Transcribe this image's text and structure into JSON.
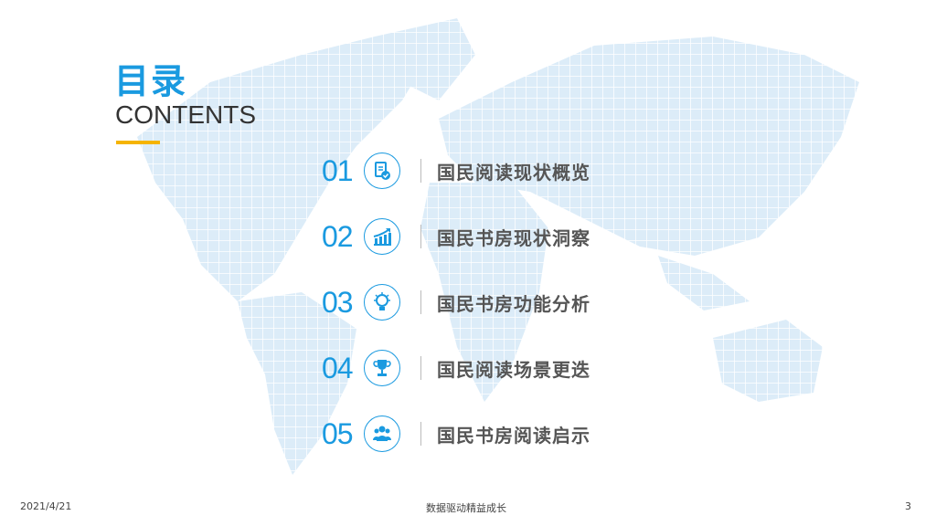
{
  "heading": {
    "title_cn": "目录",
    "title_en": "CONTENTS"
  },
  "items": [
    {
      "num": "01",
      "label": "国民阅读现状概览",
      "icon": "document-check-icon"
    },
    {
      "num": "02",
      "label": "国民书房现状洞察",
      "icon": "growth-chart-icon"
    },
    {
      "num": "03",
      "label": "国民书房功能分析",
      "icon": "lightbulb-icon"
    },
    {
      "num": "04",
      "label": "国民阅读场景更迭",
      "icon": "trophy-icon"
    },
    {
      "num": "05",
      "label": "国民书房阅读启示",
      "icon": "people-icon"
    }
  ],
  "footer": {
    "date": "2021/4/21",
    "center": "数据驱动精益成长",
    "page": "3"
  },
  "colors": {
    "accent": "#1a9ae0",
    "underline": "#f5b400",
    "text": "#555555"
  }
}
